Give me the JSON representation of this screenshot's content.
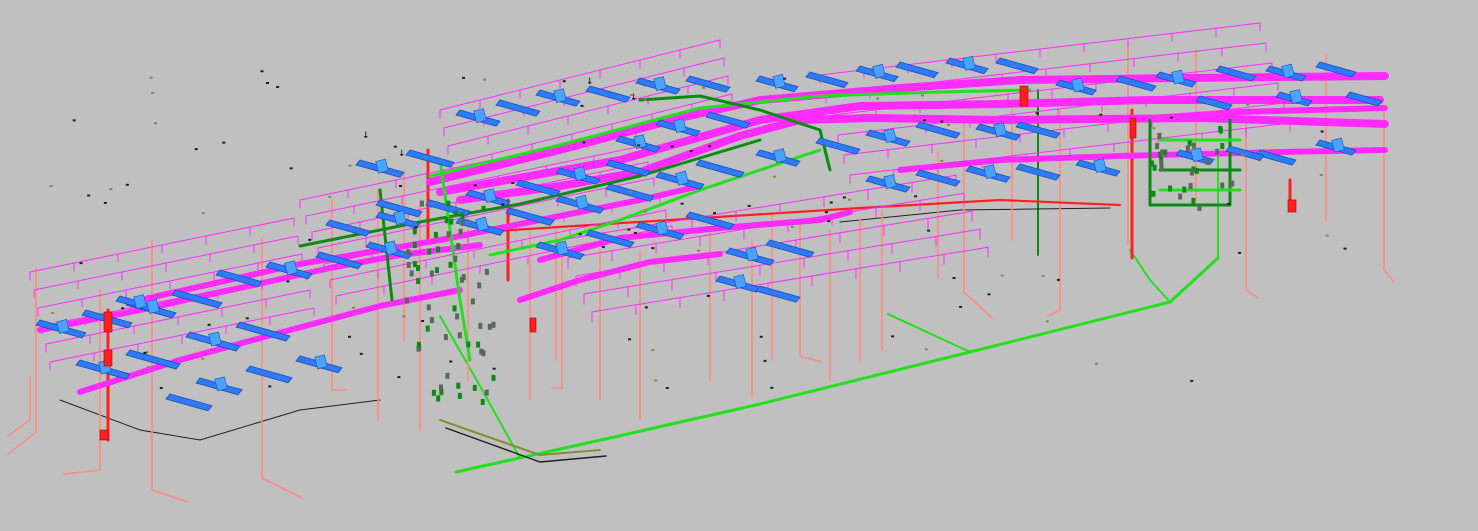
{
  "view": {
    "background": "#c0c0c0"
  },
  "colors": {
    "duct_magenta": "#ff2bff",
    "duct_blue": "#2e7bff",
    "diffuser_blue": "#4aa3ff",
    "pipe_green": "#22e01e",
    "pipe_darkgreen": "#0c8a14",
    "pipe_red": "#ff2020",
    "pipe_salmon": "#ff8a80",
    "line_black": "#202020",
    "pipe_olive": "#8a8a30"
  },
  "markers": [
    {
      "id": "m1",
      "text": "↓"
    },
    {
      "id": "m2",
      "text": "↓"
    },
    {
      "id": "m3",
      "text": "↓"
    },
    {
      "id": "m4",
      "text": "↓"
    }
  ]
}
